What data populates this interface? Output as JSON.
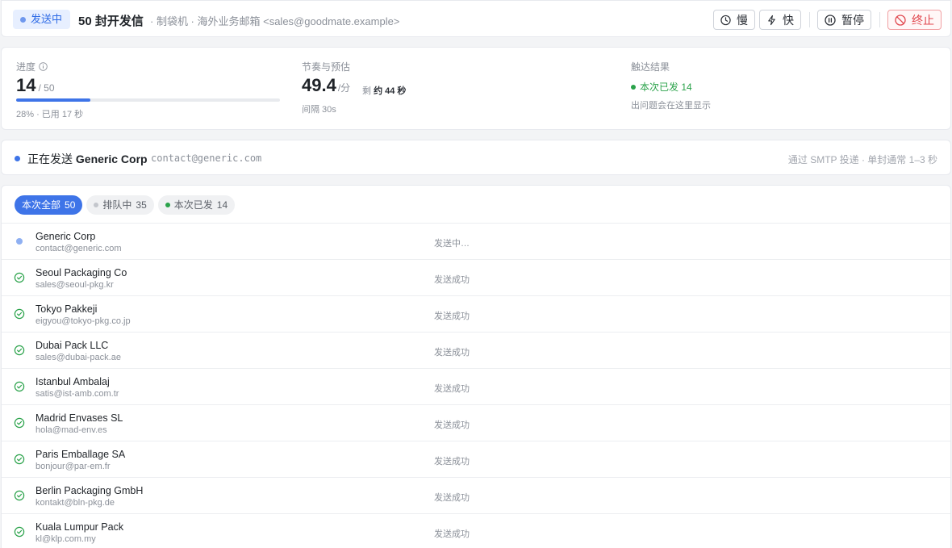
{
  "header": {
    "status_badge": "发送中",
    "title": "50 封开发信",
    "meta": "· 制袋机 · 海外业务邮箱 <sales@goodmate.example>",
    "btn_slow": "慢",
    "btn_fast": "快",
    "btn_pause": "暂停",
    "btn_stop": "终止",
    "colors": {
      "accent": "#3e74e8",
      "success": "#2aa24a",
      "danger": "#e0464d"
    }
  },
  "stats": {
    "progress_label": "进度",
    "progress_value": "14",
    "progress_total": "/ 50",
    "progress_fraction": 0.28,
    "progress_note": "28% · 已用 17 秒",
    "rate_label": "节奏与预估",
    "rate_value": "49.4",
    "rate_unit": "/分",
    "remain_prefix": "剩",
    "remain_value": "约 44 秒",
    "interval_note": "间隔 30s",
    "result_label": "触达结果",
    "result_sent": "本次已发 14",
    "result_note": "出问题会在这里显示"
  },
  "current": {
    "prefix": "正在发送",
    "company": "Generic Corp",
    "email": "contact@generic.com",
    "hint": "通过 SMTP 投递 · 单封通常 1–3 秒"
  },
  "tabs": [
    {
      "label": "本次全部",
      "count": "50"
    },
    {
      "label": "排队中",
      "count": "35"
    },
    {
      "label": "本次已发",
      "count": "14"
    }
  ],
  "rows": [
    {
      "name": "Generic Corp",
      "email": "contact@generic.com",
      "status": "发送中…",
      "state": "sending"
    },
    {
      "name": "Seoul Packaging Co",
      "email": "sales@seoul-pkg.kr",
      "status": "发送成功",
      "state": "ok"
    },
    {
      "name": "Tokyo Pakkeji",
      "email": "eigyou@tokyo-pkg.co.jp",
      "status": "发送成功",
      "state": "ok"
    },
    {
      "name": "Dubai Pack LLC",
      "email": "sales@dubai-pack.ae",
      "status": "发送成功",
      "state": "ok"
    },
    {
      "name": "Istanbul Ambalaj",
      "email": "satis@ist-amb.com.tr",
      "status": "发送成功",
      "state": "ok"
    },
    {
      "name": "Madrid Envases SL",
      "email": "hola@mad-env.es",
      "status": "发送成功",
      "state": "ok"
    },
    {
      "name": "Paris Emballage SA",
      "email": "bonjour@par-em.fr",
      "status": "发送成功",
      "state": "ok"
    },
    {
      "name": "Berlin Packaging GmbH",
      "email": "kontakt@bln-pkg.de",
      "status": "发送成功",
      "state": "ok"
    },
    {
      "name": "Kuala Lumpur Pack",
      "email": "kl@klp.com.my",
      "status": "发送成功",
      "state": "ok"
    }
  ]
}
